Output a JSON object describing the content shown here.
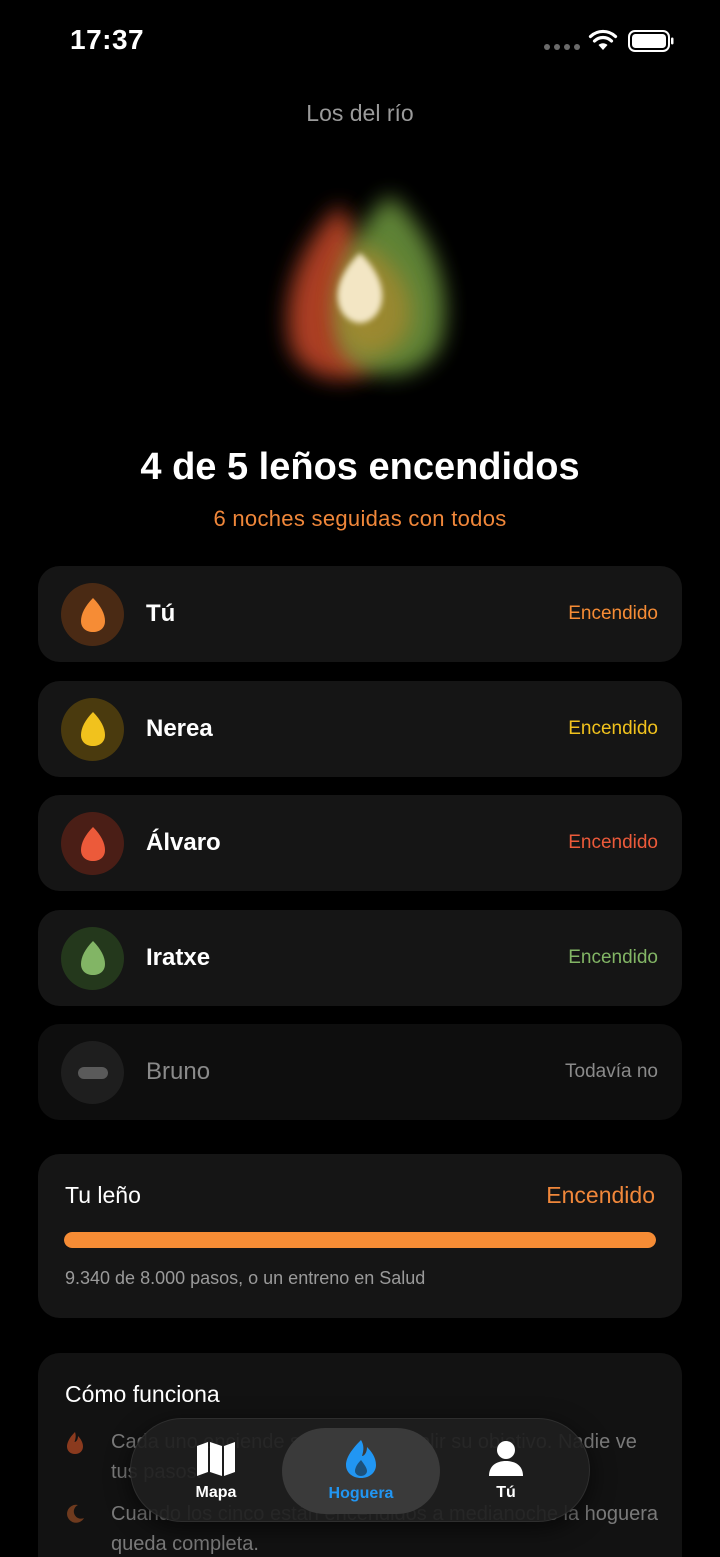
{
  "status_bar": {
    "time": "17:37"
  },
  "group_name": "Los del río",
  "headline": "4 de 5 leños encendidos",
  "streak": "6 noches seguidas con todos",
  "members": [
    {
      "name": "Tú",
      "status": "Encendido",
      "color": "#f68c35",
      "bg": "#4a2a14",
      "lit": true
    },
    {
      "name": "Nerea",
      "status": "Encendido",
      "color": "#f1c21d",
      "bg": "#4a3a0e",
      "lit": true
    },
    {
      "name": "Álvaro",
      "status": "Encendido",
      "color": "#ec5a3a",
      "bg": "#4a1e16",
      "lit": true
    },
    {
      "name": "Iratxe",
      "status": "Encendido",
      "color": "#82b565",
      "bg": "#24381c",
      "lit": true
    },
    {
      "name": "Bruno",
      "status": "Todavía no",
      "color": "#8a8a8a",
      "bg": "#222222",
      "lit": false
    }
  ],
  "log_card": {
    "title": "Tu leño",
    "status": "Encendido",
    "progress": 1.0,
    "detail": "9.340 de 8.000 pasos, o un entreno en Salud"
  },
  "how_it_works": {
    "title": "Cómo funciona",
    "items": [
      {
        "icon": "flame-icon",
        "text": "Cada uno enciende su leño al cumplir su objetivo. Nadie ve tus pasos."
      },
      {
        "icon": "moon-icon",
        "text": "Cuando los cinco están encendidos a medianoche la hoguera queda completa."
      }
    ]
  },
  "tabs": [
    {
      "label": "Mapa",
      "icon": "map-icon",
      "active": false
    },
    {
      "label": "Hoguera",
      "icon": "flame-icon",
      "active": true
    },
    {
      "label": "Tú",
      "icon": "person-icon",
      "active": false
    }
  ],
  "colors": {
    "accent": "#f0873a",
    "active_tab": "#2196f3",
    "background": "#000000",
    "card": "#151515"
  }
}
